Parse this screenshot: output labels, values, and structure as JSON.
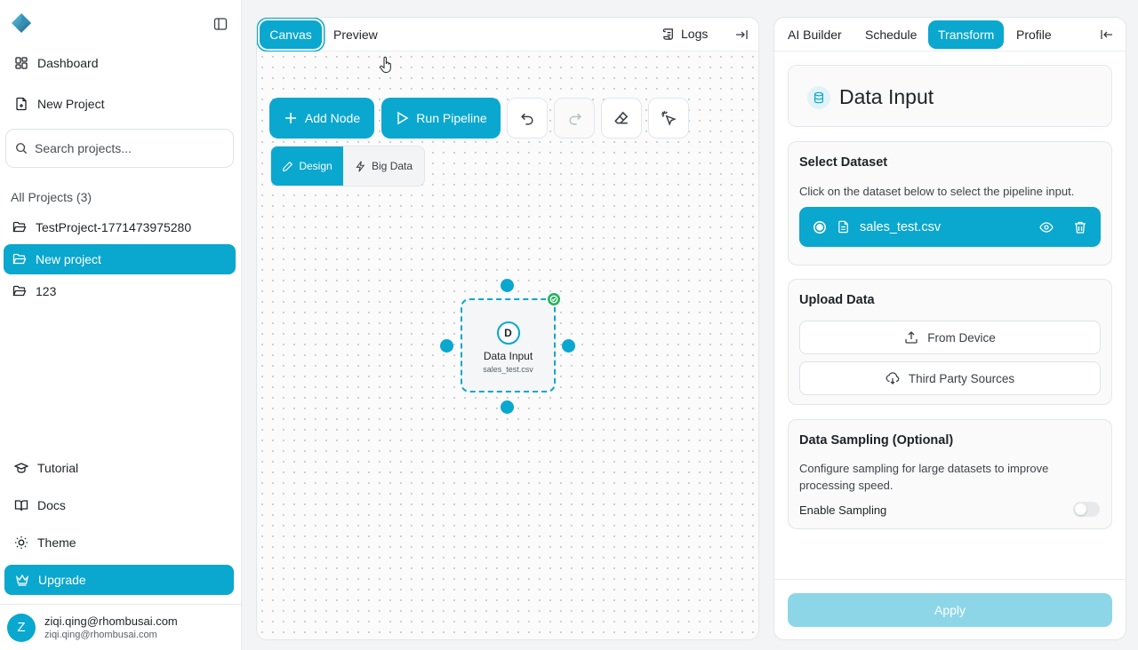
{
  "colors": {
    "accent": "#0aa7cf",
    "success": "#22b35a",
    "apply_disabled": "#8dd6e8"
  },
  "sidebar": {
    "nav": [
      {
        "label": "Dashboard",
        "icon": "dashboard-icon"
      },
      {
        "label": "New Project",
        "icon": "new-file-icon"
      }
    ],
    "search_placeholder": "Search projects...",
    "projects_header": "All Projects (3)",
    "projects": [
      {
        "label": "TestProject-1771473975280",
        "active": false
      },
      {
        "label": "New project",
        "active": true
      },
      {
        "label": "123",
        "active": false
      }
    ],
    "bottom": [
      {
        "label": "Tutorial",
        "icon": "graduation-cap-icon"
      },
      {
        "label": "Docs",
        "icon": "book-icon"
      },
      {
        "label": "Theme",
        "icon": "sun-icon"
      }
    ],
    "upgrade_label": "Upgrade",
    "user": {
      "initial": "Z",
      "name": "ziqi.qing@rhombusai.com",
      "email": "ziqi.qing@rhombusai.com"
    }
  },
  "canvas": {
    "tabs": {
      "canvas": "Canvas",
      "preview": "Preview"
    },
    "logs_label": "Logs",
    "toolbar": {
      "add_node": "Add Node",
      "run_pipeline": "Run Pipeline",
      "design": "Design",
      "big_data": "Big Data"
    },
    "node": {
      "badge": "D",
      "title": "Data Input",
      "subtitle": "sales_test.csv",
      "status": "success"
    }
  },
  "panel": {
    "tabs": [
      "AI Builder",
      "Schedule",
      "Transform",
      "Profile"
    ],
    "active_tab": "Transform",
    "title": "Data Input",
    "select_dataset": {
      "title": "Select Dataset",
      "description": "Click on the dataset below to select the pipeline input.",
      "dataset": "sales_test.csv"
    },
    "upload": {
      "title": "Upload Data",
      "from_device": "From Device",
      "third_party": "Third Party Sources"
    },
    "sampling": {
      "title": "Data Sampling (Optional)",
      "description_line1": "Configure sampling for large datasets to improve",
      "description_line2": "processing speed.",
      "toggle_label": "Enable Sampling",
      "enabled": false
    },
    "apply_label": "Apply"
  }
}
